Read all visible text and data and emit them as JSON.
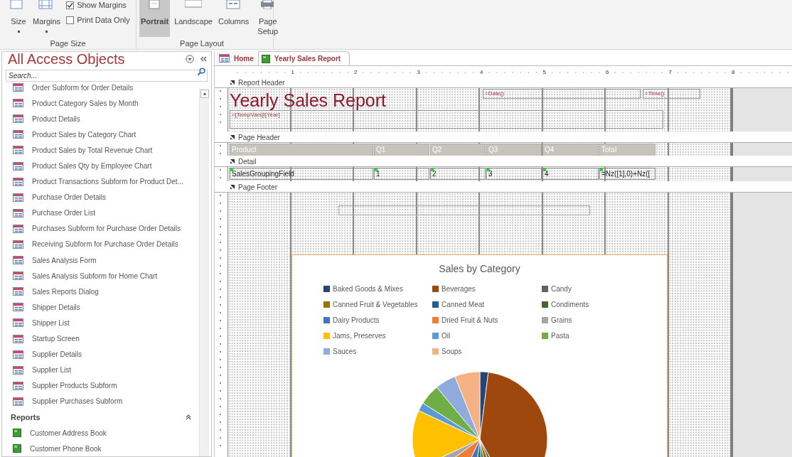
{
  "ribbon": {
    "groups": [
      {
        "label": "Page Size",
        "buttons": [
          {
            "label": "Size",
            "kind": "size",
            "dropdown": true
          },
          {
            "label": "Margins",
            "kind": "margins",
            "dropdown": true
          }
        ],
        "checkboxes": [
          {
            "label": "Show Margins",
            "checked": true
          },
          {
            "label": "Print Data Only",
            "checked": false
          }
        ]
      },
      {
        "label": "Page Layout",
        "buttons": [
          {
            "label": "Portrait",
            "kind": "portrait",
            "selected": true
          },
          {
            "label": "Landscape",
            "kind": "landscape",
            "selected": false
          },
          {
            "label": "Columns",
            "kind": "columns",
            "selected": false
          },
          {
            "label": "Page Setup",
            "kind": "setup",
            "selected": false
          }
        ]
      }
    ]
  },
  "nav_pane": {
    "title": "All Access Objects",
    "search": {
      "placeholder": "Search..."
    },
    "groups": [
      {
        "items": [
          {
            "label": "Order Subform for Order Details",
            "kind": "form"
          },
          {
            "label": "Product Category Sales by Month",
            "kind": "form"
          },
          {
            "label": "Product Details",
            "kind": "form"
          },
          {
            "label": "Product Sales by Category Chart",
            "kind": "form"
          },
          {
            "label": "Product Sales by Total Revenue Chart",
            "kind": "form"
          },
          {
            "label": "Product Sales Qty by Employee Chart",
            "kind": "form"
          },
          {
            "label": "Product Transactions Subform for Product Det...",
            "kind": "form"
          },
          {
            "label": "Purchase Order Details",
            "kind": "form"
          },
          {
            "label": "Purchase Order List",
            "kind": "form"
          },
          {
            "label": "Purchases Subform for Purchase Order Details",
            "kind": "form"
          },
          {
            "label": "Receiving Subform for Purchase Order Details",
            "kind": "form"
          },
          {
            "label": "Sales Analysis Form",
            "kind": "form"
          },
          {
            "label": "Sales Analysis Subform for Home Chart",
            "kind": "form"
          },
          {
            "label": "Sales Reports Dialog",
            "kind": "form"
          },
          {
            "label": "Shipper Details",
            "kind": "form"
          },
          {
            "label": "Shipper List",
            "kind": "form"
          },
          {
            "label": "Startup Screen",
            "kind": "form"
          },
          {
            "label": "Supplier Details",
            "kind": "form"
          },
          {
            "label": "Supplier List",
            "kind": "form"
          },
          {
            "label": "Supplier Products Subform",
            "kind": "form"
          },
          {
            "label": "Supplier Purchases Subform",
            "kind": "form"
          }
        ]
      },
      {
        "heading": "Reports",
        "items": [
          {
            "label": "Customer Address Book",
            "kind": "report"
          },
          {
            "label": "Customer Phone Book",
            "kind": "report"
          }
        ]
      }
    ]
  },
  "tabs": [
    {
      "label": "Home",
      "kind": "form",
      "selected": false
    },
    {
      "label": "Yearly Sales Report",
      "kind": "report",
      "selected": true
    }
  ],
  "ruler": [
    "1",
    "2",
    "3",
    "4",
    "5",
    "6",
    "7",
    "8"
  ],
  "sections": [
    {
      "title": "Report Header",
      "kind": "report_header",
      "controls": [
        {
          "kind": "title",
          "text": "Yearly Sales Report"
        },
        {
          "kind": "expression",
          "text": "=Date()"
        },
        {
          "kind": "expression",
          "text": "=Time()"
        },
        {
          "kind": "expression",
          "text": "=[TempVars]![Year]"
        }
      ]
    },
    {
      "title": "Page Header",
      "kind": "page_header",
      "controls": [
        {
          "kind": "label",
          "text": "Product"
        },
        {
          "kind": "label",
          "text": "Q1"
        },
        {
          "kind": "label",
          "text": "Q2"
        },
        {
          "kind": "label",
          "text": "Q3"
        },
        {
          "kind": "label",
          "text": "Q4"
        },
        {
          "kind": "label",
          "text": "Total"
        }
      ]
    },
    {
      "title": "Detail",
      "kind": "detail",
      "controls": [
        {
          "kind": "field",
          "text": "SalesGroupingField"
        },
        {
          "kind": "field",
          "text": "1"
        },
        {
          "kind": "field",
          "text": "2"
        },
        {
          "kind": "field",
          "text": "3"
        },
        {
          "kind": "field",
          "text": "4"
        },
        {
          "kind": "field",
          "text": "=Nz([1],0)+Nz(["
        }
      ]
    },
    {
      "title": "Page Footer",
      "kind": "page_footer",
      "controls": [
        {
          "kind": "blank"
        }
      ],
      "chart": {
        "title": "Sales by Category",
        "legend": [
          {
            "label": "Baked Goods & Mixes",
            "color": "#264478"
          },
          {
            "label": "Beverages",
            "color": "#9e480e"
          },
          {
            "label": "Candy",
            "color": "#636363"
          },
          {
            "label": "Canned Fruit & Vegetables",
            "color": "#997300"
          },
          {
            "label": "Canned Meat",
            "color": "#255e91"
          },
          {
            "label": "Condiments",
            "color": "#43682b"
          },
          {
            "label": "Dairy Products",
            "color": "#4472c4"
          },
          {
            "label": "Dried Fruit & Nuts",
            "color": "#ed7d31"
          },
          {
            "label": "Grains",
            "color": "#a5a5a5"
          },
          {
            "label": "Jams, Preserves",
            "color": "#ffc000"
          },
          {
            "label": "Oil",
            "color": "#5b9bd5"
          },
          {
            "label": "Pasta",
            "color": "#70ad47"
          },
          {
            "label": "Sauces",
            "color": "#8faadc"
          },
          {
            "label": "Soups",
            "color": "#f4b183"
          }
        ]
      }
    }
  ]
}
